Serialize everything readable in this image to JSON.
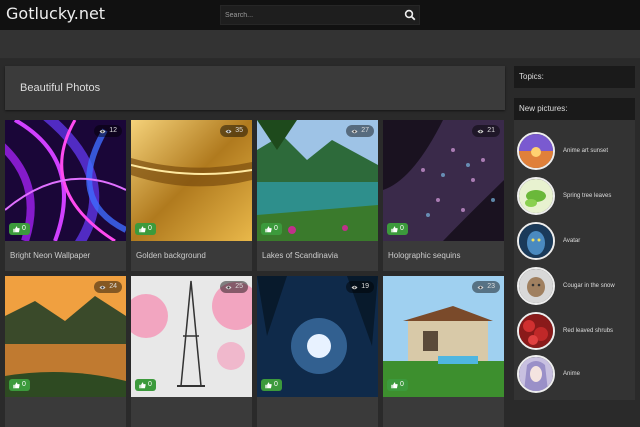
{
  "header": {
    "logo": "Gotlucky.net",
    "search_placeholder": "Search..."
  },
  "main": {
    "title": "Beautiful Photos",
    "photos": [
      {
        "name": "Bright Neon Wallpaper",
        "views": "12",
        "likes": "0"
      },
      {
        "name": "Golden background",
        "views": "35",
        "likes": "0"
      },
      {
        "name": "Lakes of Scandinavia",
        "views": "27",
        "likes": "0"
      },
      {
        "name": "Holographic sequins",
        "views": "21",
        "likes": "0"
      },
      {
        "name": "",
        "views": "24",
        "likes": "0"
      },
      {
        "name": "",
        "views": "25",
        "likes": "0"
      },
      {
        "name": "",
        "views": "19",
        "likes": "0"
      },
      {
        "name": "",
        "views": "23",
        "likes": "0"
      }
    ]
  },
  "sidebar": {
    "topics_label": "Topics:",
    "new_pictures_label": "New pictures:",
    "items": [
      {
        "label": "Anime art sunset"
      },
      {
        "label": "Spring tree leaves"
      },
      {
        "label": "Avatar"
      },
      {
        "label": "Cougar in the snow"
      },
      {
        "label": "Red leaved shrubs"
      },
      {
        "label": "Anime"
      }
    ]
  },
  "colors": {
    "like_badge": "#3c9a3c",
    "header_bg": "#111111",
    "page_bg": "#2a2a2a"
  }
}
